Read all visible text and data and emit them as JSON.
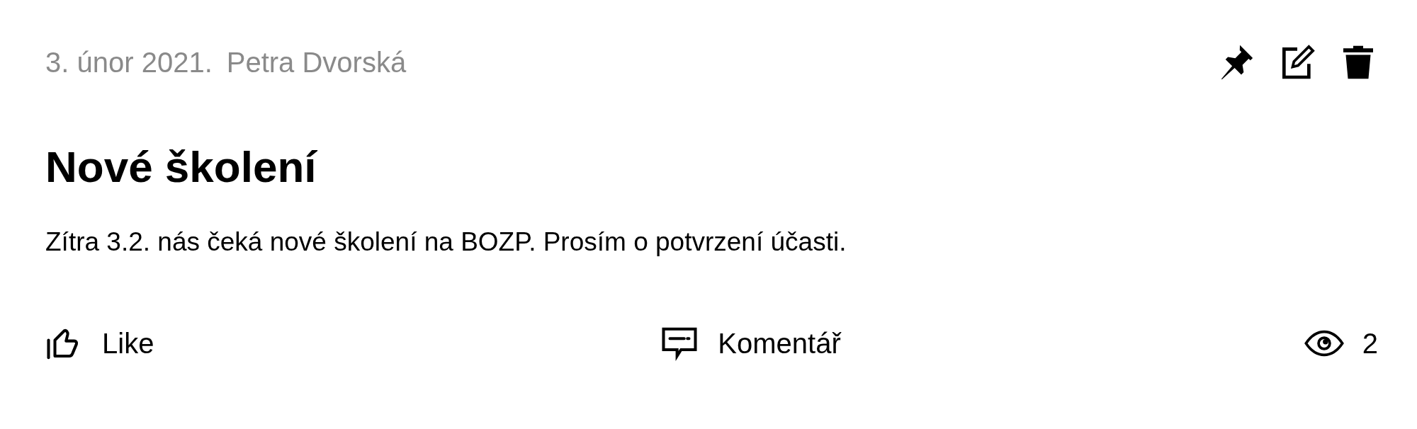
{
  "post": {
    "date": "3. únor 2021.",
    "author": "Petra Dvorská",
    "title": "Nové školení",
    "body": "Zítra 3.2. nás čeká nové školení na BOZP. Prosím o potvrzení účasti."
  },
  "actions": [
    {
      "kind": "like",
      "label": "Like"
    },
    {
      "kind": "comment",
      "label": "Komentář"
    },
    {
      "kind": "views",
      "label": "2"
    }
  ]
}
